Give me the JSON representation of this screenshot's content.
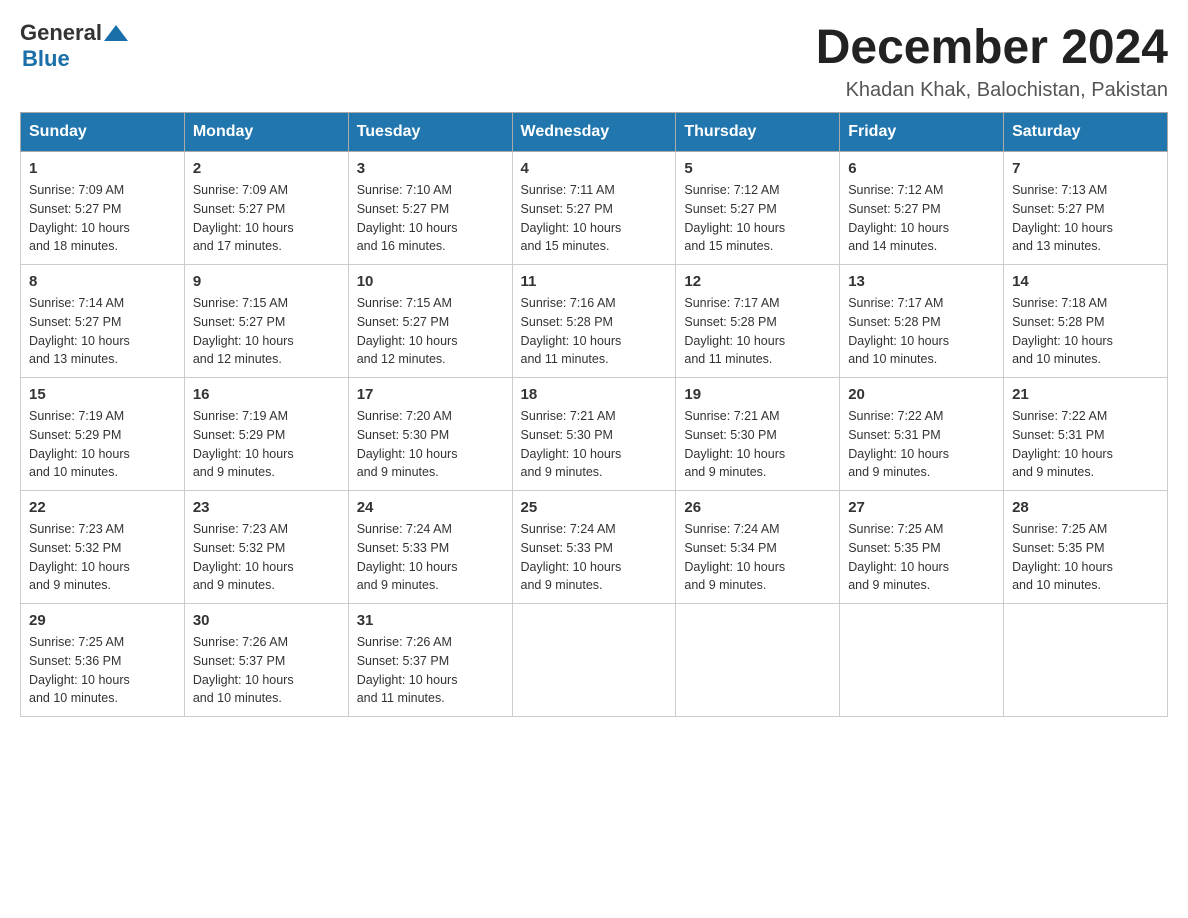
{
  "header": {
    "logo_text_general": "General",
    "logo_text_blue": "Blue",
    "month_year": "December 2024",
    "location": "Khadan Khak, Balochistan, Pakistan"
  },
  "weekdays": [
    "Sunday",
    "Monday",
    "Tuesday",
    "Wednesday",
    "Thursday",
    "Friday",
    "Saturday"
  ],
  "weeks": [
    [
      {
        "day": "1",
        "sunrise": "7:09 AM",
        "sunset": "5:27 PM",
        "daylight": "10 hours and 18 minutes."
      },
      {
        "day": "2",
        "sunrise": "7:09 AM",
        "sunset": "5:27 PM",
        "daylight": "10 hours and 17 minutes."
      },
      {
        "day": "3",
        "sunrise": "7:10 AM",
        "sunset": "5:27 PM",
        "daylight": "10 hours and 16 minutes."
      },
      {
        "day": "4",
        "sunrise": "7:11 AM",
        "sunset": "5:27 PM",
        "daylight": "10 hours and 15 minutes."
      },
      {
        "day": "5",
        "sunrise": "7:12 AM",
        "sunset": "5:27 PM",
        "daylight": "10 hours and 15 minutes."
      },
      {
        "day": "6",
        "sunrise": "7:12 AM",
        "sunset": "5:27 PM",
        "daylight": "10 hours and 14 minutes."
      },
      {
        "day": "7",
        "sunrise": "7:13 AM",
        "sunset": "5:27 PM",
        "daylight": "10 hours and 13 minutes."
      }
    ],
    [
      {
        "day": "8",
        "sunrise": "7:14 AM",
        "sunset": "5:27 PM",
        "daylight": "10 hours and 13 minutes."
      },
      {
        "day": "9",
        "sunrise": "7:15 AM",
        "sunset": "5:27 PM",
        "daylight": "10 hours and 12 minutes."
      },
      {
        "day": "10",
        "sunrise": "7:15 AM",
        "sunset": "5:27 PM",
        "daylight": "10 hours and 12 minutes."
      },
      {
        "day": "11",
        "sunrise": "7:16 AM",
        "sunset": "5:28 PM",
        "daylight": "10 hours and 11 minutes."
      },
      {
        "day": "12",
        "sunrise": "7:17 AM",
        "sunset": "5:28 PM",
        "daylight": "10 hours and 11 minutes."
      },
      {
        "day": "13",
        "sunrise": "7:17 AM",
        "sunset": "5:28 PM",
        "daylight": "10 hours and 10 minutes."
      },
      {
        "day": "14",
        "sunrise": "7:18 AM",
        "sunset": "5:28 PM",
        "daylight": "10 hours and 10 minutes."
      }
    ],
    [
      {
        "day": "15",
        "sunrise": "7:19 AM",
        "sunset": "5:29 PM",
        "daylight": "10 hours and 10 minutes."
      },
      {
        "day": "16",
        "sunrise": "7:19 AM",
        "sunset": "5:29 PM",
        "daylight": "10 hours and 9 minutes."
      },
      {
        "day": "17",
        "sunrise": "7:20 AM",
        "sunset": "5:30 PM",
        "daylight": "10 hours and 9 minutes."
      },
      {
        "day": "18",
        "sunrise": "7:21 AM",
        "sunset": "5:30 PM",
        "daylight": "10 hours and 9 minutes."
      },
      {
        "day": "19",
        "sunrise": "7:21 AM",
        "sunset": "5:30 PM",
        "daylight": "10 hours and 9 minutes."
      },
      {
        "day": "20",
        "sunrise": "7:22 AM",
        "sunset": "5:31 PM",
        "daylight": "10 hours and 9 minutes."
      },
      {
        "day": "21",
        "sunrise": "7:22 AM",
        "sunset": "5:31 PM",
        "daylight": "10 hours and 9 minutes."
      }
    ],
    [
      {
        "day": "22",
        "sunrise": "7:23 AM",
        "sunset": "5:32 PM",
        "daylight": "10 hours and 9 minutes."
      },
      {
        "day": "23",
        "sunrise": "7:23 AM",
        "sunset": "5:32 PM",
        "daylight": "10 hours and 9 minutes."
      },
      {
        "day": "24",
        "sunrise": "7:24 AM",
        "sunset": "5:33 PM",
        "daylight": "10 hours and 9 minutes."
      },
      {
        "day": "25",
        "sunrise": "7:24 AM",
        "sunset": "5:33 PM",
        "daylight": "10 hours and 9 minutes."
      },
      {
        "day": "26",
        "sunrise": "7:24 AM",
        "sunset": "5:34 PM",
        "daylight": "10 hours and 9 minutes."
      },
      {
        "day": "27",
        "sunrise": "7:25 AM",
        "sunset": "5:35 PM",
        "daylight": "10 hours and 9 minutes."
      },
      {
        "day": "28",
        "sunrise": "7:25 AM",
        "sunset": "5:35 PM",
        "daylight": "10 hours and 10 minutes."
      }
    ],
    [
      {
        "day": "29",
        "sunrise": "7:25 AM",
        "sunset": "5:36 PM",
        "daylight": "10 hours and 10 minutes."
      },
      {
        "day": "30",
        "sunrise": "7:26 AM",
        "sunset": "5:37 PM",
        "daylight": "10 hours and 10 minutes."
      },
      {
        "day": "31",
        "sunrise": "7:26 AM",
        "sunset": "5:37 PM",
        "daylight": "10 hours and 11 minutes."
      },
      null,
      null,
      null,
      null
    ]
  ],
  "labels": {
    "sunrise": "Sunrise:",
    "sunset": "Sunset:",
    "daylight": "Daylight:"
  }
}
